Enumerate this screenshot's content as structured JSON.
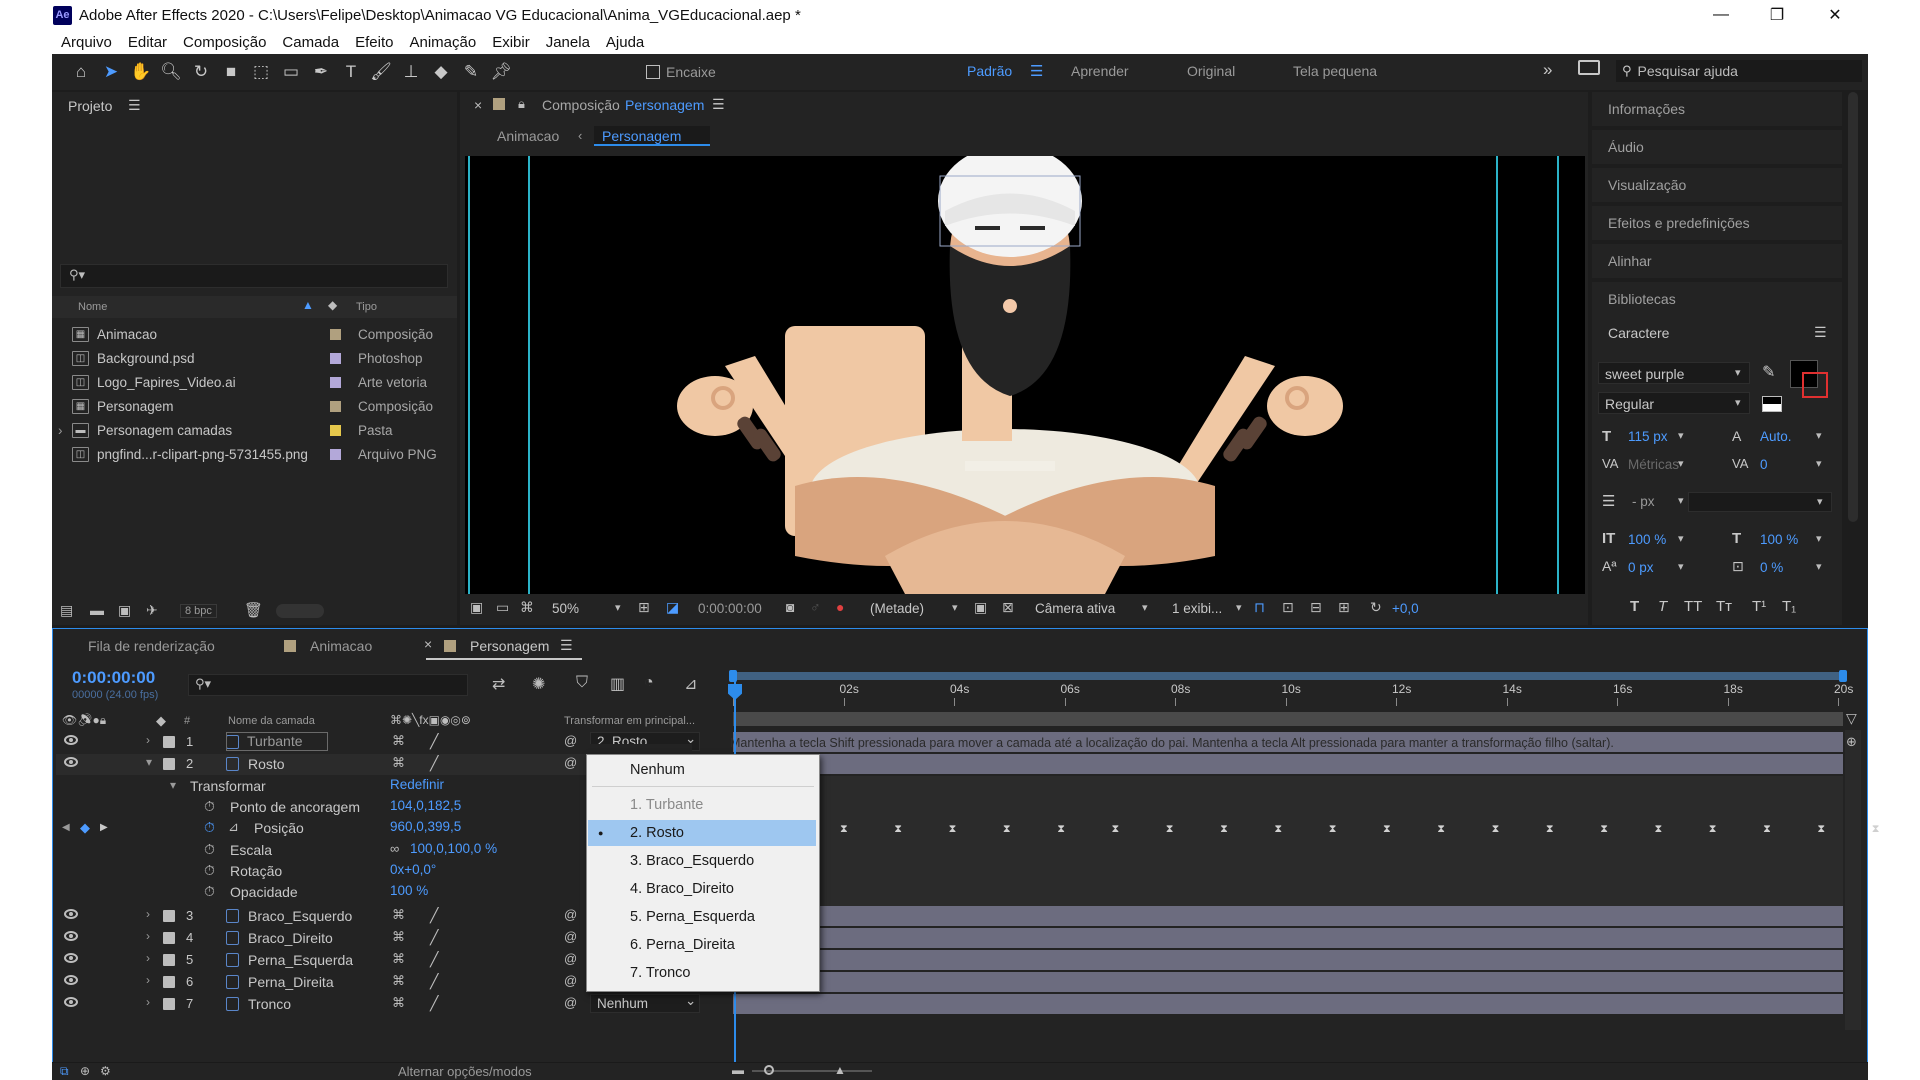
{
  "window": {
    "title": "Adobe After Effects 2020 - C:\\Users\\Felipe\\Desktop\\Animacao VG Educacional\\Anima_VGEducacional.aep *",
    "app_icon": "Ae",
    "minimize": "—",
    "maximize": "❐",
    "close": "✕"
  },
  "menu": [
    "Arquivo",
    "Editar",
    "Composição",
    "Camada",
    "Efeito",
    "Animação",
    "Exibir",
    "Janela",
    "Ajuda"
  ],
  "toolbar": {
    "snap_label": "Encaixe",
    "workspaces": [
      "Padrão",
      "Aprender",
      "Original",
      "Tela pequena"
    ],
    "more": "»",
    "search_placeholder": "Pesquisar ajuda"
  },
  "project": {
    "title": "Projeto",
    "col_name": "Nome",
    "col_type": "Tipo",
    "bpc": "8 bpc",
    "items": [
      {
        "name": "Animacao",
        "type": "Composição",
        "swatch": "#b0a07f"
      },
      {
        "name": "Background.psd",
        "type": "Photoshop",
        "swatch": "#b3a8d9"
      },
      {
        "name": "Logo_Fapires_Video.ai",
        "type": "Arte vetoria",
        "swatch": "#b3a8d9"
      },
      {
        "name": "Personagem",
        "type": "Composição",
        "swatch": "#b0a07f"
      },
      {
        "name": "Personagem camadas",
        "type": "Pasta",
        "swatch": "#e6c84c"
      },
      {
        "name": "pngfind...r-clipart-png-5731455.png",
        "type": "Arquivo PNG",
        "swatch": "#b3a8d9"
      }
    ]
  },
  "composition": {
    "tab_prefix": "Composição",
    "tab_name": "Personagem",
    "breadcrumb_parent": "Animacao",
    "breadcrumb_current": "Personagem",
    "zoom": "50%",
    "timecode": "0:00:00:00",
    "resolution": "(Metade)",
    "camera": "Câmera ativa",
    "views": "1 exibi...",
    "exposure": "+0,0"
  },
  "right_panels": [
    "Informações",
    "Áudio",
    "Visualização",
    "Efeitos e predefinições",
    "Alinhar",
    "Bibliotecas"
  ],
  "character": {
    "title": "Caractere",
    "font": "sweet purple",
    "style": "Regular",
    "size": "115 px",
    "leading": "Auto.",
    "kerning": "Métricas",
    "tracking": "0",
    "stroke": "- px",
    "vscale": "100 %",
    "hscale": "100 %",
    "baseline": "0 px",
    "tsume": "0 %"
  },
  "timeline": {
    "tabs": [
      "Fila de renderização",
      "Animacao",
      "Personagem"
    ],
    "timecode": "0:00:00:00",
    "fps": "00000 (24.00 fps)",
    "col_layer_name": "Nome da camada",
    "col_parent": "Transformar em principal...",
    "ruler": [
      "0s",
      "02s",
      "04s",
      "06s",
      "08s",
      "10s",
      "12s",
      "14s",
      "16s",
      "18s",
      "20s"
    ],
    "tooltip": "Mantenha a tecla Shift pressionada para mover a camada até a localização do pai. Mantenha a tecla Alt pressionada para manter a transformação filho (saltar).",
    "layers": [
      {
        "num": "1",
        "name": "Turbante",
        "parent": "2. Rosto"
      },
      {
        "num": "2",
        "name": "Rosto",
        "parent": ""
      },
      {
        "num": "3",
        "name": "Braco_Esquerdo",
        "parent": ""
      },
      {
        "num": "4",
        "name": "Braco_Direito",
        "parent": ""
      },
      {
        "num": "5",
        "name": "Perna_Esquerda",
        "parent": ""
      },
      {
        "num": "6",
        "name": "Perna_Direita",
        "parent": ""
      },
      {
        "num": "7",
        "name": "Tronco",
        "parent": "Nenhum"
      }
    ],
    "transform": {
      "label": "Transformar",
      "reset": "Redefinir",
      "props": [
        {
          "name": "Ponto de ancoragem",
          "value": "104,0,182,5"
        },
        {
          "name": "Posição",
          "value": "960,0,399,5"
        },
        {
          "name": "Escala",
          "value": "100,0,100,0 %"
        },
        {
          "name": "Rotação",
          "value": "0x+0,0°"
        },
        {
          "name": "Opacidade",
          "value": "100 %"
        }
      ]
    },
    "footer": "Alternar opções/modos"
  },
  "dropdown": {
    "items": [
      "Nenhum",
      "1. Turbante",
      "2. Rosto",
      "3. Braco_Esquerdo",
      "4. Braco_Direito",
      "5. Perna_Esquerda",
      "6. Perna_Direita",
      "7. Tronco"
    ],
    "selected": "2. Rosto",
    "disabled": "1. Turbante"
  },
  "colors": {
    "accent": "#2d8ceb",
    "timecode": "#4d9bff",
    "track": "#6c6c7f",
    "selection": "#9ec7f0"
  }
}
